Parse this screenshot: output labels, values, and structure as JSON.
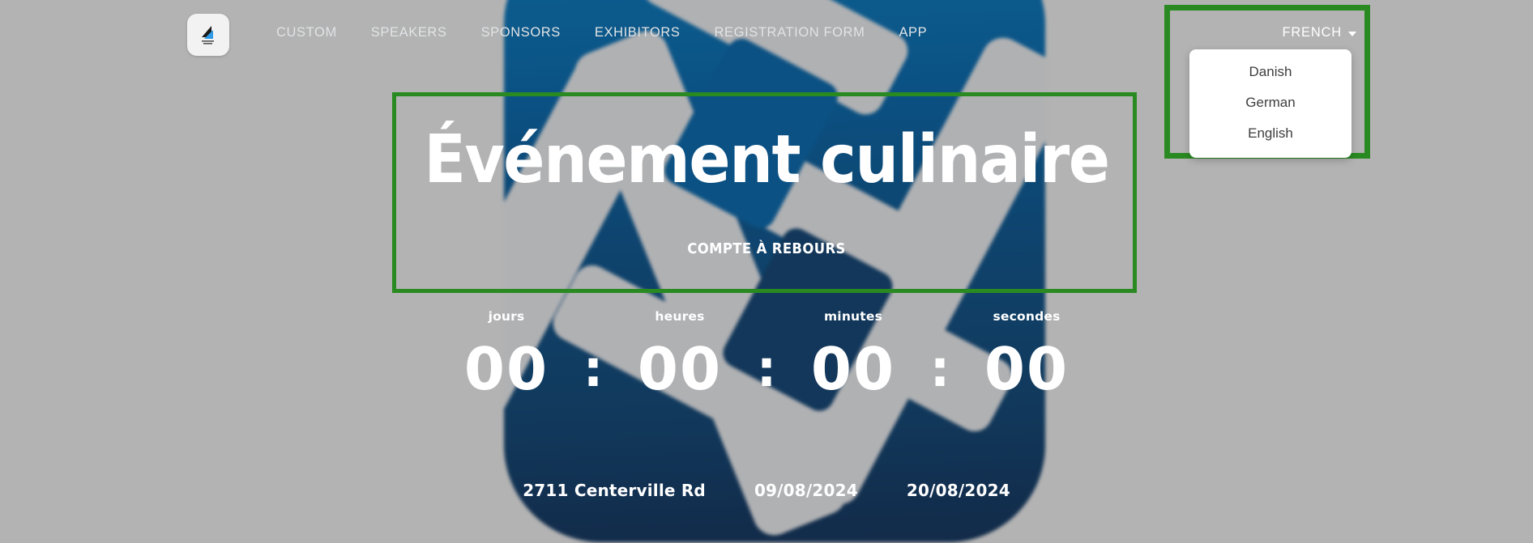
{
  "colors": {
    "page_background": "#b3b3b3",
    "highlight_green": "#2a8a22",
    "hero_blue_top": "#0e5f92",
    "hero_blue_bottom": "#122b49",
    "hero_mark_gray": "#b0b1b3",
    "nav_link": "#e3e6e8",
    "menu_text": "#3d3d3d",
    "menu_background": "#ffffff"
  },
  "navbar": {
    "logo_alt": "site-logo",
    "links": [
      {
        "label": "CUSTOM"
      },
      {
        "label": "SPEAKERS"
      },
      {
        "label": "SPONSORS"
      },
      {
        "label": "EXHIBITORS"
      },
      {
        "label": "REGISTRATION FORM"
      },
      {
        "label": "APP"
      }
    ]
  },
  "language_selector": {
    "selected": "FRENCH",
    "caret_icon": "chevron-down-icon",
    "options": [
      {
        "label": "Danish"
      },
      {
        "label": "German"
      },
      {
        "label": "English"
      }
    ]
  },
  "hero": {
    "title": "Événement culinaire",
    "subtitle": "COMPTE À REBOURS"
  },
  "countdown": {
    "separator": ":",
    "units": [
      {
        "label": "jours",
        "value": "00"
      },
      {
        "label": "heures",
        "value": "00"
      },
      {
        "label": "minutes",
        "value": "00"
      },
      {
        "label": "secondes",
        "value": "00"
      }
    ]
  },
  "event_meta": {
    "location": "2711 Centerville Rd",
    "start_date": "09/08/2024",
    "end_date": "20/08/2024"
  }
}
